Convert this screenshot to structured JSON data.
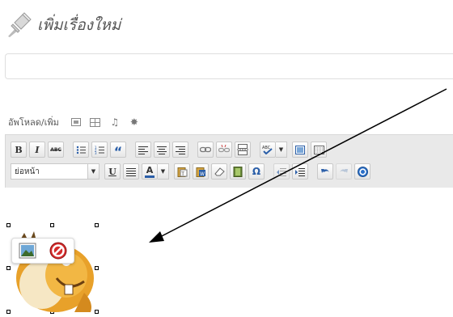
{
  "header": {
    "title": "เพิ่มเรื่องใหม่",
    "pin_icon": "pushpin-icon"
  },
  "media": {
    "label": "อัพโหลด/เพิ่ม",
    "icons": [
      "image-upload-icon",
      "video-upload-icon",
      "audio-upload-icon",
      "media-upload-icon"
    ]
  },
  "toolbar": {
    "bold": "B",
    "italic": "I",
    "strike": "ABC",
    "blockquote": "“",
    "format_select": "ย่อหน้า",
    "underline": "U",
    "text_color": "A",
    "omega": "Ω"
  },
  "colors": {
    "toolbar_bg": "#e9e9e9",
    "button_border": "#c9c9c9",
    "accent": "#21759b",
    "delete": "#d42c2c"
  }
}
